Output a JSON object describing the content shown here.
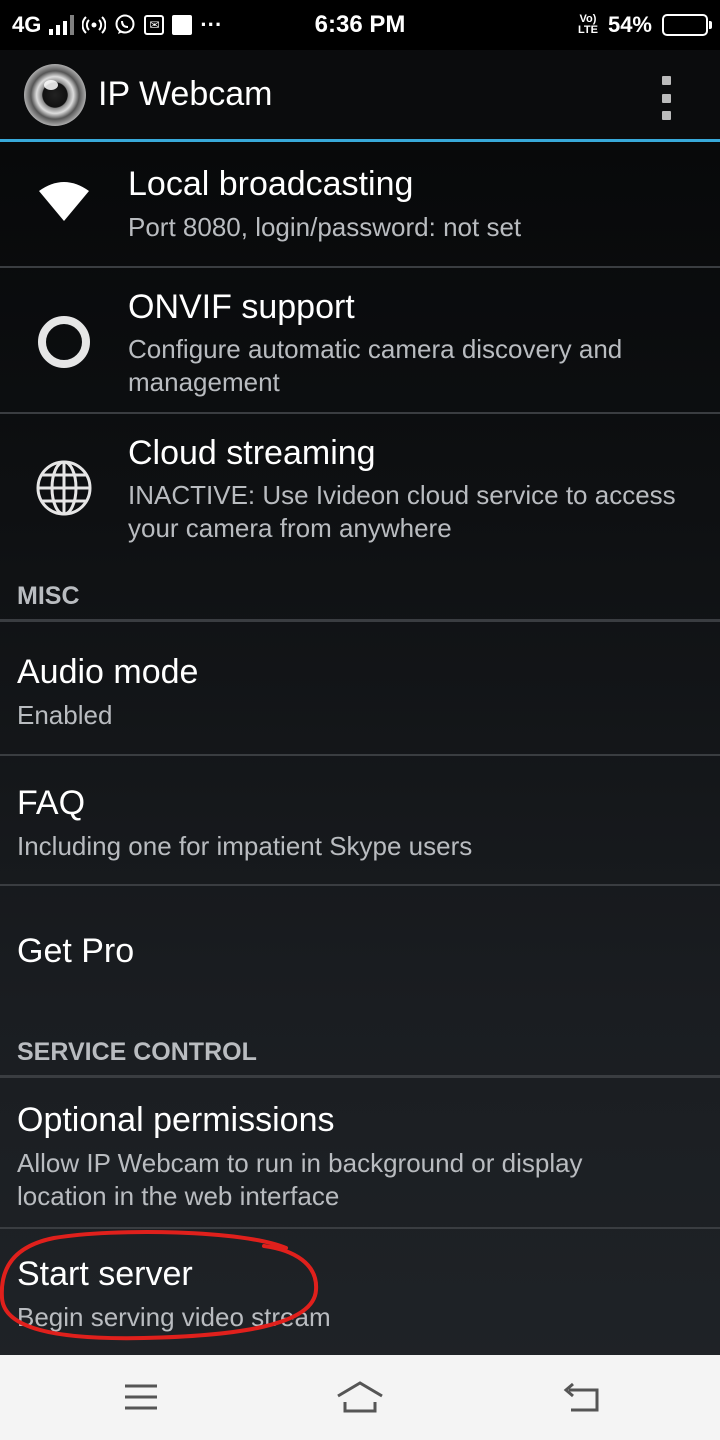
{
  "status_bar": {
    "network": "4G",
    "time": "6:36 PM",
    "volte": "Vo) LTE",
    "battery": "54%",
    "battery_level": 0.54
  },
  "app": {
    "title": "IP Webcam"
  },
  "items": [
    {
      "title": "Local broadcasting",
      "subtitle": "Port 8080, login/password: not set",
      "icon": "wifi-icon"
    },
    {
      "title": "ONVIF support",
      "subtitle": "Configure automatic camera discovery and management",
      "icon": "ring-icon"
    },
    {
      "title": "Cloud streaming",
      "subtitle": "INACTIVE: Use Ivideon cloud service to access your camera from anywhere",
      "icon": "globe-icon"
    }
  ],
  "sections": {
    "misc": "MISC",
    "service_control": "SERVICE CONTROL"
  },
  "misc_items": [
    {
      "title": "Audio mode",
      "subtitle": "Enabled"
    },
    {
      "title": "FAQ",
      "subtitle": "Including one for impatient Skype users"
    },
    {
      "title": "Get Pro"
    }
  ],
  "service_items": [
    {
      "title": "Optional permissions",
      "subtitle": "Allow IP Webcam to run in background or display location in the web interface"
    },
    {
      "title": "Start server",
      "subtitle": "Begin serving video stream"
    }
  ],
  "colors": {
    "accent": "#38a9d9",
    "highlight": "#e0201c"
  }
}
